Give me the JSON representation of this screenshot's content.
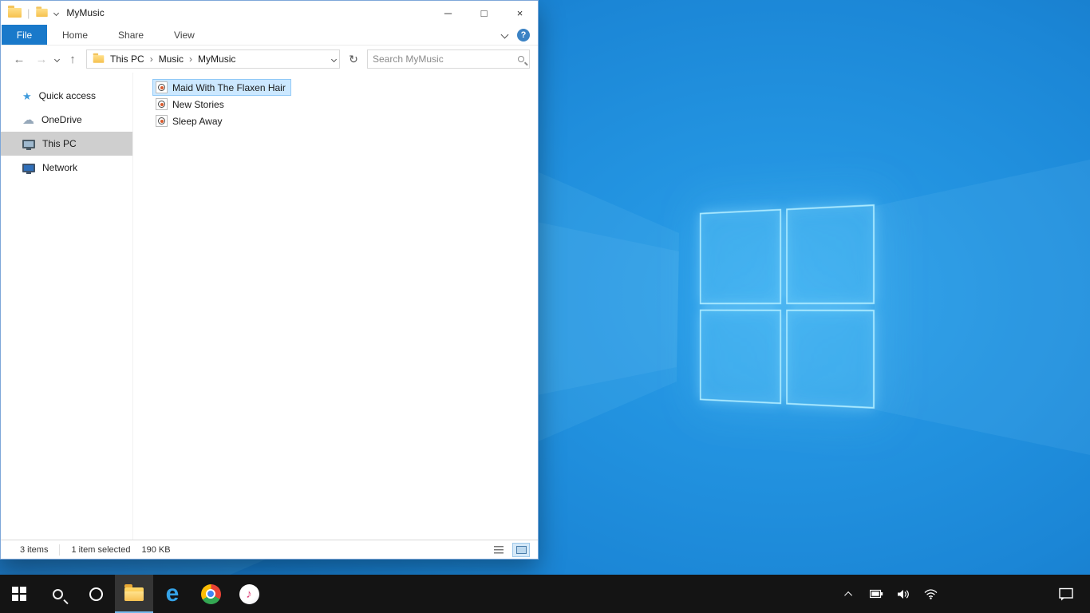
{
  "glyphs": {
    "star": "★",
    "cloud": "☁",
    "edge_e": "e",
    "itunes_note": "♪"
  },
  "colors": {
    "accent": "#1979ca",
    "selection_bg": "#cce8ff",
    "selection_border": "#91c9f7",
    "nav_selected_bg": "#cfcfcf",
    "taskbar_bg": "#141414",
    "desktop_blue": "#1b86d6"
  },
  "explorer": {
    "titlebar": {
      "title": "MyMusic",
      "separator": "|",
      "minimize": "─",
      "maximize": "□",
      "close": "×"
    },
    "ribbon": {
      "file_tab": "File",
      "tabs": [
        {
          "label": "Home"
        },
        {
          "label": "Share"
        },
        {
          "label": "View"
        }
      ],
      "help": "?"
    },
    "addressbar": {
      "back": "←",
      "forward": "→",
      "up": "↑",
      "refresh": "↻",
      "separator": "›",
      "breadcrumbs": [
        {
          "label": "This PC"
        },
        {
          "label": "Music"
        },
        {
          "label": "MyMusic"
        }
      ]
    },
    "search": {
      "placeholder": "Search MyMusic"
    },
    "nav": [
      {
        "label": "Quick access",
        "icon": "star-icon"
      },
      {
        "label": "OneDrive",
        "icon": "cloud-icon"
      },
      {
        "label": "This PC",
        "icon": "pc-icon",
        "selected": true
      },
      {
        "label": "Network",
        "icon": "network-icon"
      }
    ],
    "files": [
      {
        "name": "Maid With The Flaxen Hair",
        "selected": true
      },
      {
        "name": "New Stories",
        "selected": false
      },
      {
        "name": "Sleep Away",
        "selected": false
      }
    ],
    "statusbar": {
      "count": "3 items",
      "selected": "1 item selected",
      "size": "190 KB"
    }
  },
  "taskbar": {
    "apps": [
      "start",
      "search",
      "cortana",
      "file-explorer",
      "edge",
      "chrome",
      "itunes"
    ],
    "active_app": "file-explorer",
    "tray_icons": [
      "hidden-icons-chevron",
      "battery",
      "volume",
      "wifi",
      "action-center"
    ]
  }
}
